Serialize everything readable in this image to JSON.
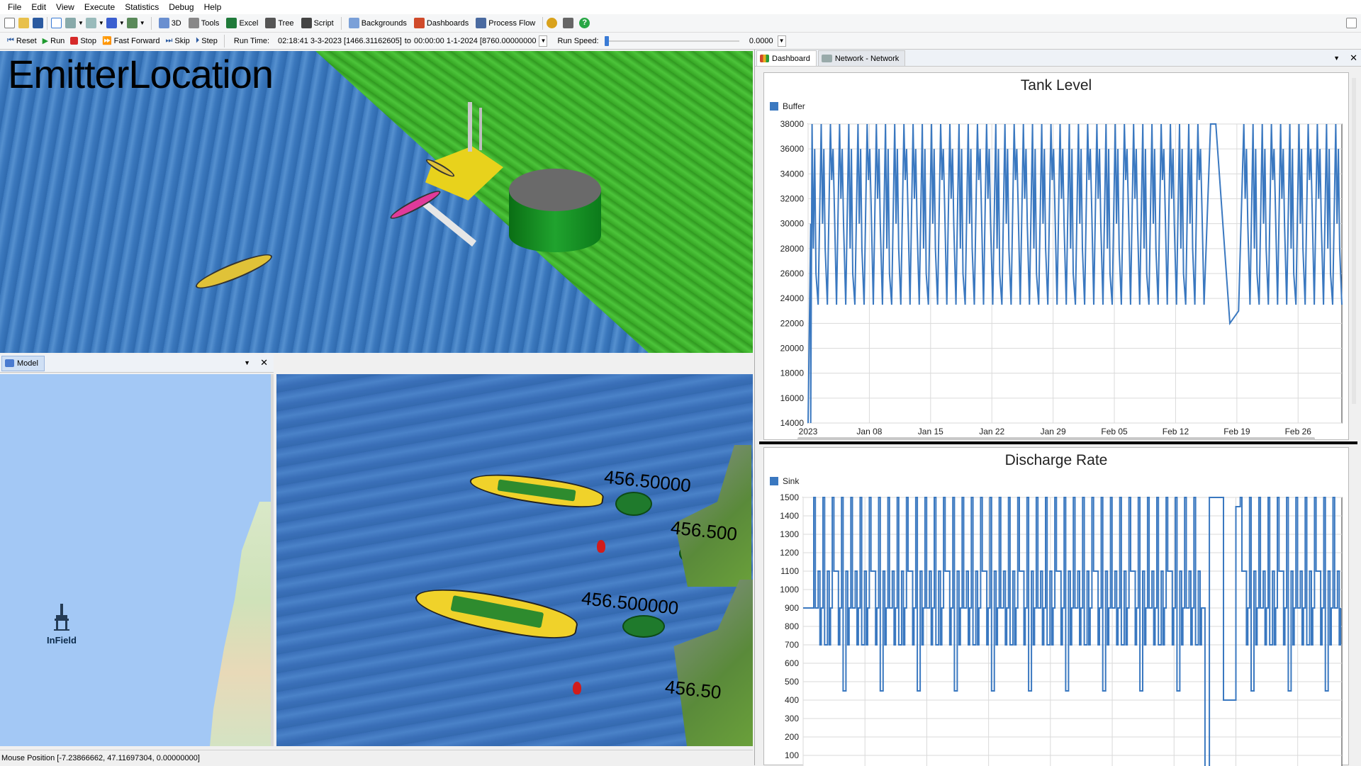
{
  "menu": [
    "File",
    "Edit",
    "View",
    "Execute",
    "Statistics",
    "Debug",
    "Help"
  ],
  "toolbar1": {
    "buttons": [
      "3D",
      "Tools",
      "Excel",
      "Tree",
      "Script",
      "Backgrounds",
      "Dashboards",
      "Process Flow"
    ]
  },
  "toolbar2": {
    "reset": "Reset",
    "run": "Run",
    "stop": "Stop",
    "fast_forward": "Fast Forward",
    "skip": "Skip",
    "step": "Step",
    "run_time_label": "Run Time:",
    "run_time_value": "02:18:41  3-3-2023  [1466.31162605]",
    "to_label": "to",
    "stop_time_value": "00:00:00  1-1-2024  [8760.00000000",
    "run_speed_label": "Run Speed:",
    "run_speed_value": "0.0000"
  },
  "view3d": {
    "title": "EmitterLocation"
  },
  "model_panel": {
    "tab": "Model",
    "infield_label": "InField"
  },
  "berths": {
    "label1": "456.50000",
    "label2": "456.500",
    "label3": "456.500000",
    "label4": "456.50"
  },
  "statusbar": {
    "mouse_position": "Mouse Position [-7.23866662, 47.11697304, 0.00000000]"
  },
  "dashboard": {
    "tabs": [
      "Dashboard",
      "Network - Network"
    ]
  },
  "colors": {
    "series": "#3a78c0"
  },
  "chart_data": [
    {
      "type": "line",
      "title": "Tank Level",
      "series": [
        {
          "name": "Buffer"
        }
      ],
      "x_ticks": [
        "2023",
        "Jan 08",
        "Jan 15",
        "Jan 22",
        "Jan 29",
        "Feb 05",
        "Feb 12",
        "Feb 19",
        "Feb 26"
      ],
      "y_ticks": [
        14000,
        16000,
        18000,
        20000,
        22000,
        24000,
        26000,
        28000,
        30000,
        32000,
        34000,
        36000,
        38000
      ],
      "ylim": [
        14000,
        38000
      ],
      "xlim_days": [
        0,
        61
      ],
      "pattern": {
        "high": 38000,
        "low": 23500,
        "mid_values": [
          28000,
          30000,
          33500,
          32000
        ],
        "cycle_days": 1.05
      },
      "anomalies": [
        {
          "day": 0.3,
          "value": 14000
        },
        {
          "day": 46,
          "value": 38000
        },
        {
          "day": 46.6,
          "value": 38000
        },
        {
          "day": 48.2,
          "value": 22000
        },
        {
          "day": 49.2,
          "value": 23000
        }
      ]
    },
    {
      "type": "line",
      "title": "Discharge Rate",
      "series": [
        {
          "name": "Sink"
        }
      ],
      "y_ticks": [
        100,
        200,
        300,
        400,
        500,
        600,
        700,
        800,
        900,
        1000,
        1100,
        1200,
        1300,
        1400,
        1500
      ],
      "ylim": [
        0,
        1500
      ],
      "xlim_days": [
        0,
        61
      ],
      "pattern": {
        "high": 1500,
        "levels": [
          900,
          700,
          1100,
          450
        ],
        "cycle_days": 1.05
      },
      "anomalies": [
        {
          "day": 45.5,
          "value": 0
        },
        {
          "day": 46.0,
          "value": 1500
        },
        {
          "day": 47.6,
          "value": 400
        },
        {
          "day": 49.0,
          "value": 1450
        }
      ]
    }
  ]
}
